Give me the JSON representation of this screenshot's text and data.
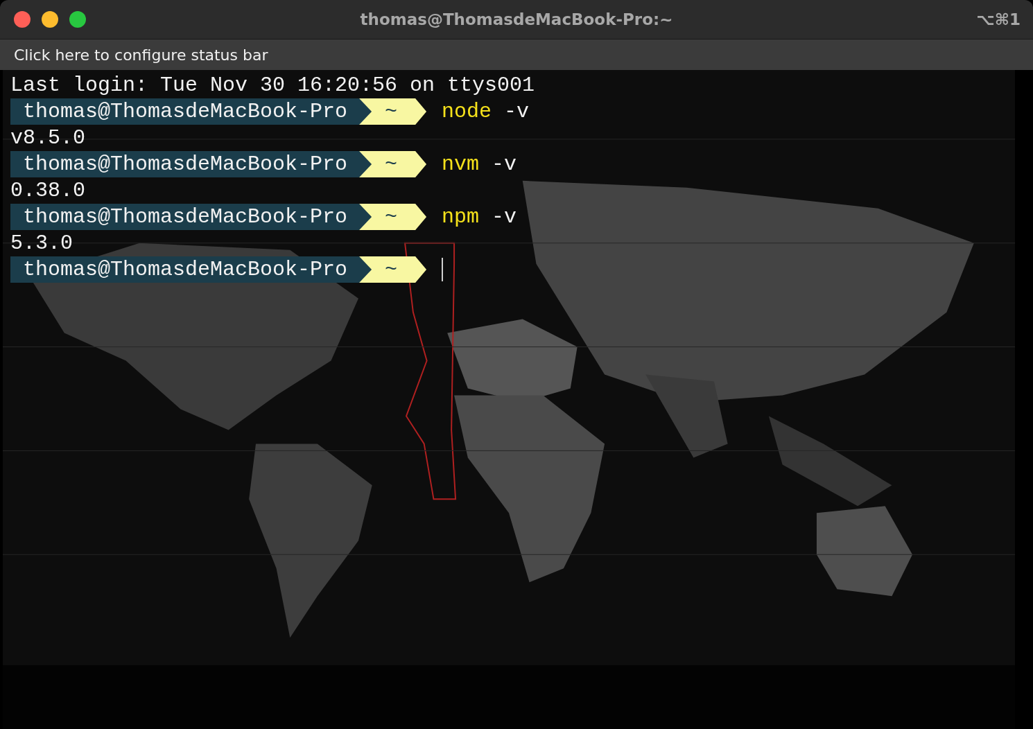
{
  "window": {
    "title": "thomas@ThomasdeMacBook-Pro:~",
    "shortcut": "⌥⌘1",
    "buttons": [
      {
        "kind": "close"
      },
      {
        "kind": "minimize"
      },
      {
        "kind": "zoom"
      }
    ]
  },
  "status_bar": {
    "text": "Click here to configure status bar"
  },
  "terminal": {
    "lines": [
      {
        "kind": "output",
        "text": "Last login: Tue Nov 30 16:20:56 on ttys001"
      },
      {
        "kind": "prompt",
        "user_host": "thomas@ThomasdeMacBook-Pro",
        "directory": "~",
        "command": "node",
        "args": "-v"
      },
      {
        "kind": "output",
        "text": "v8.5.0"
      },
      {
        "kind": "prompt",
        "user_host": "thomas@ThomasdeMacBook-Pro",
        "directory": "~",
        "command": "nvm",
        "args": "-v"
      },
      {
        "kind": "output",
        "text": "0.38.0"
      },
      {
        "kind": "prompt",
        "user_host": "thomas@ThomasdeMacBook-Pro",
        "directory": "~",
        "command": "npm",
        "args": "-v"
      },
      {
        "kind": "output",
        "text": "5.3.0"
      },
      {
        "kind": "prompt",
        "user_host": "thomas@ThomasdeMacBook-Pro",
        "directory": "~",
        "cursor": true
      }
    ]
  }
}
